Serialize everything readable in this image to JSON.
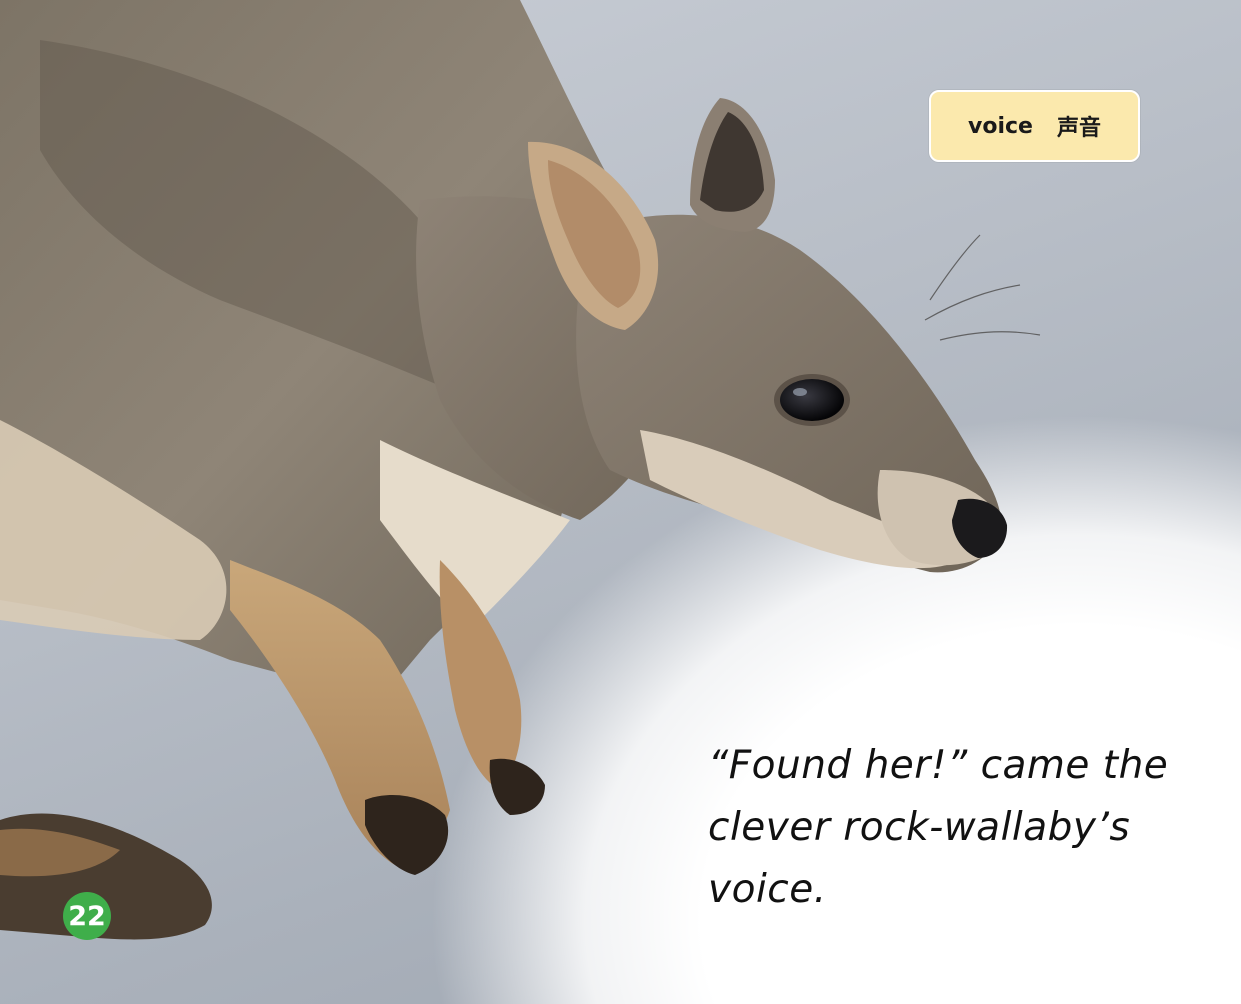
{
  "vocab": {
    "word": "voice",
    "translation": "声音"
  },
  "story": {
    "lines": [
      "“Found her!” came the",
      "clever rock-wallaby’s",
      "voice."
    ]
  },
  "page_number": "22",
  "colors": {
    "vocab_bg": "#fbe9ad",
    "page_badge": "#3fae4a",
    "text": "#111111"
  }
}
